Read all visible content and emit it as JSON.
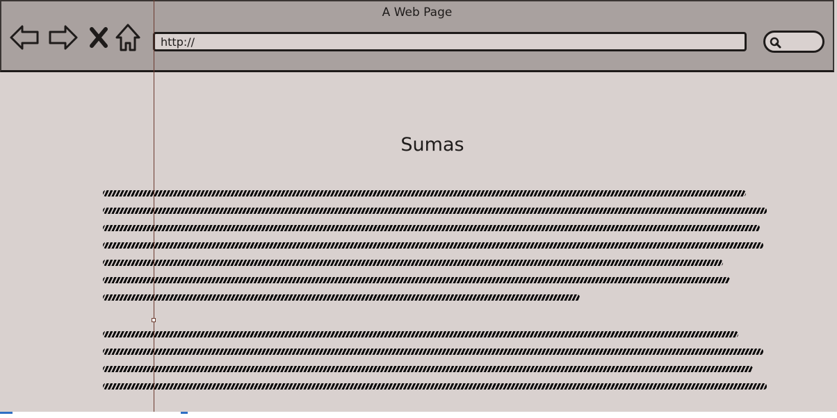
{
  "browser": {
    "window_title": "A Web Page",
    "address": "http://",
    "icons": [
      "back-icon",
      "forward-icon",
      "stop-icon",
      "home-icon",
      "search-icon"
    ]
  },
  "page": {
    "heading": "Sumas"
  },
  "colors": {
    "chrome": "#a9a19f",
    "page_background": "#d9d1cf",
    "ink": "#1e1b1a",
    "guide": "#6b3a2e"
  }
}
